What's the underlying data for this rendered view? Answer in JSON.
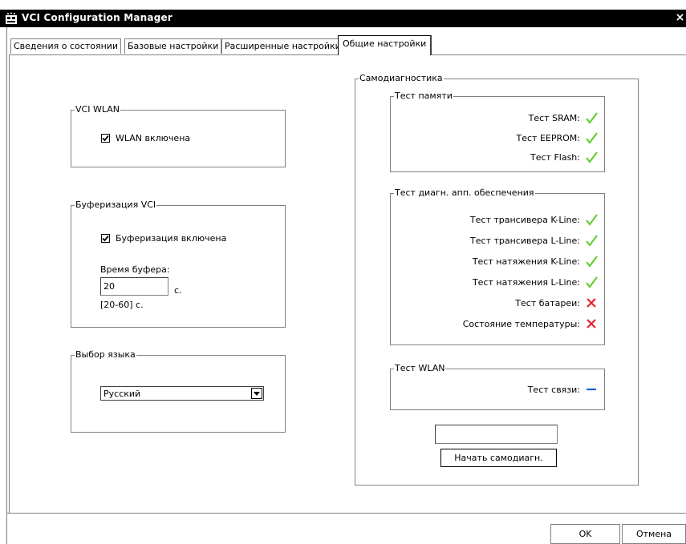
{
  "window": {
    "title": "VCI Configuration Manager",
    "close_label": "×"
  },
  "tabs": [
    {
      "label": "Сведения о состоянии",
      "active": false
    },
    {
      "label": "Базовые настройки",
      "active": false
    },
    {
      "label": "Расширенные настройки",
      "active": false
    },
    {
      "label": "Общие настройки",
      "active": true
    }
  ],
  "wlan": {
    "group_label": "VCI WLAN",
    "checkbox_label": "WLAN включена",
    "checked": true
  },
  "buffering": {
    "group_label": "Буферизация VCI",
    "checkbox_label": "Буферизация включена",
    "checked": true,
    "time_label": "Время буфера:",
    "time_value": "20",
    "unit": "с.",
    "range": "[20-60] с."
  },
  "language": {
    "group_label": "Выбор языка",
    "selected": "Русский"
  },
  "selfdiag": {
    "group_label": "Самодиагностика",
    "memory": {
      "group_label": "Тест памяти",
      "tests": [
        {
          "label": "Тест SRAM:",
          "status": "pass"
        },
        {
          "label": "Тест EEPROM:",
          "status": "pass"
        },
        {
          "label": "Тест Flash:",
          "status": "pass"
        }
      ]
    },
    "hardware": {
      "group_label": "Тест диагн. апп. обеспечения",
      "tests": [
        {
          "label": "Тест трансивера K-Line:",
          "status": "pass"
        },
        {
          "label": "Тест трансивера L-Line:",
          "status": "pass"
        },
        {
          "label": "Тест натяжения K-Line:",
          "status": "pass"
        },
        {
          "label": "Тест натяжения L-Line:",
          "status": "pass"
        },
        {
          "label": "Тест батареи:",
          "status": "fail"
        },
        {
          "label": "Состояние температуры:",
          "status": "fail"
        }
      ]
    },
    "wlan_test": {
      "group_label": "Тест WLAN",
      "tests": [
        {
          "label": "Тест связи:",
          "status": "none"
        }
      ]
    },
    "result_field": "",
    "start_button": "Начать самодиагн."
  },
  "footer": {
    "ok_label": "OK",
    "cancel_label": "Отмена"
  },
  "colors": {
    "pass": "#66cc33",
    "fail": "#e8242f",
    "none": "#1f5fd6"
  }
}
